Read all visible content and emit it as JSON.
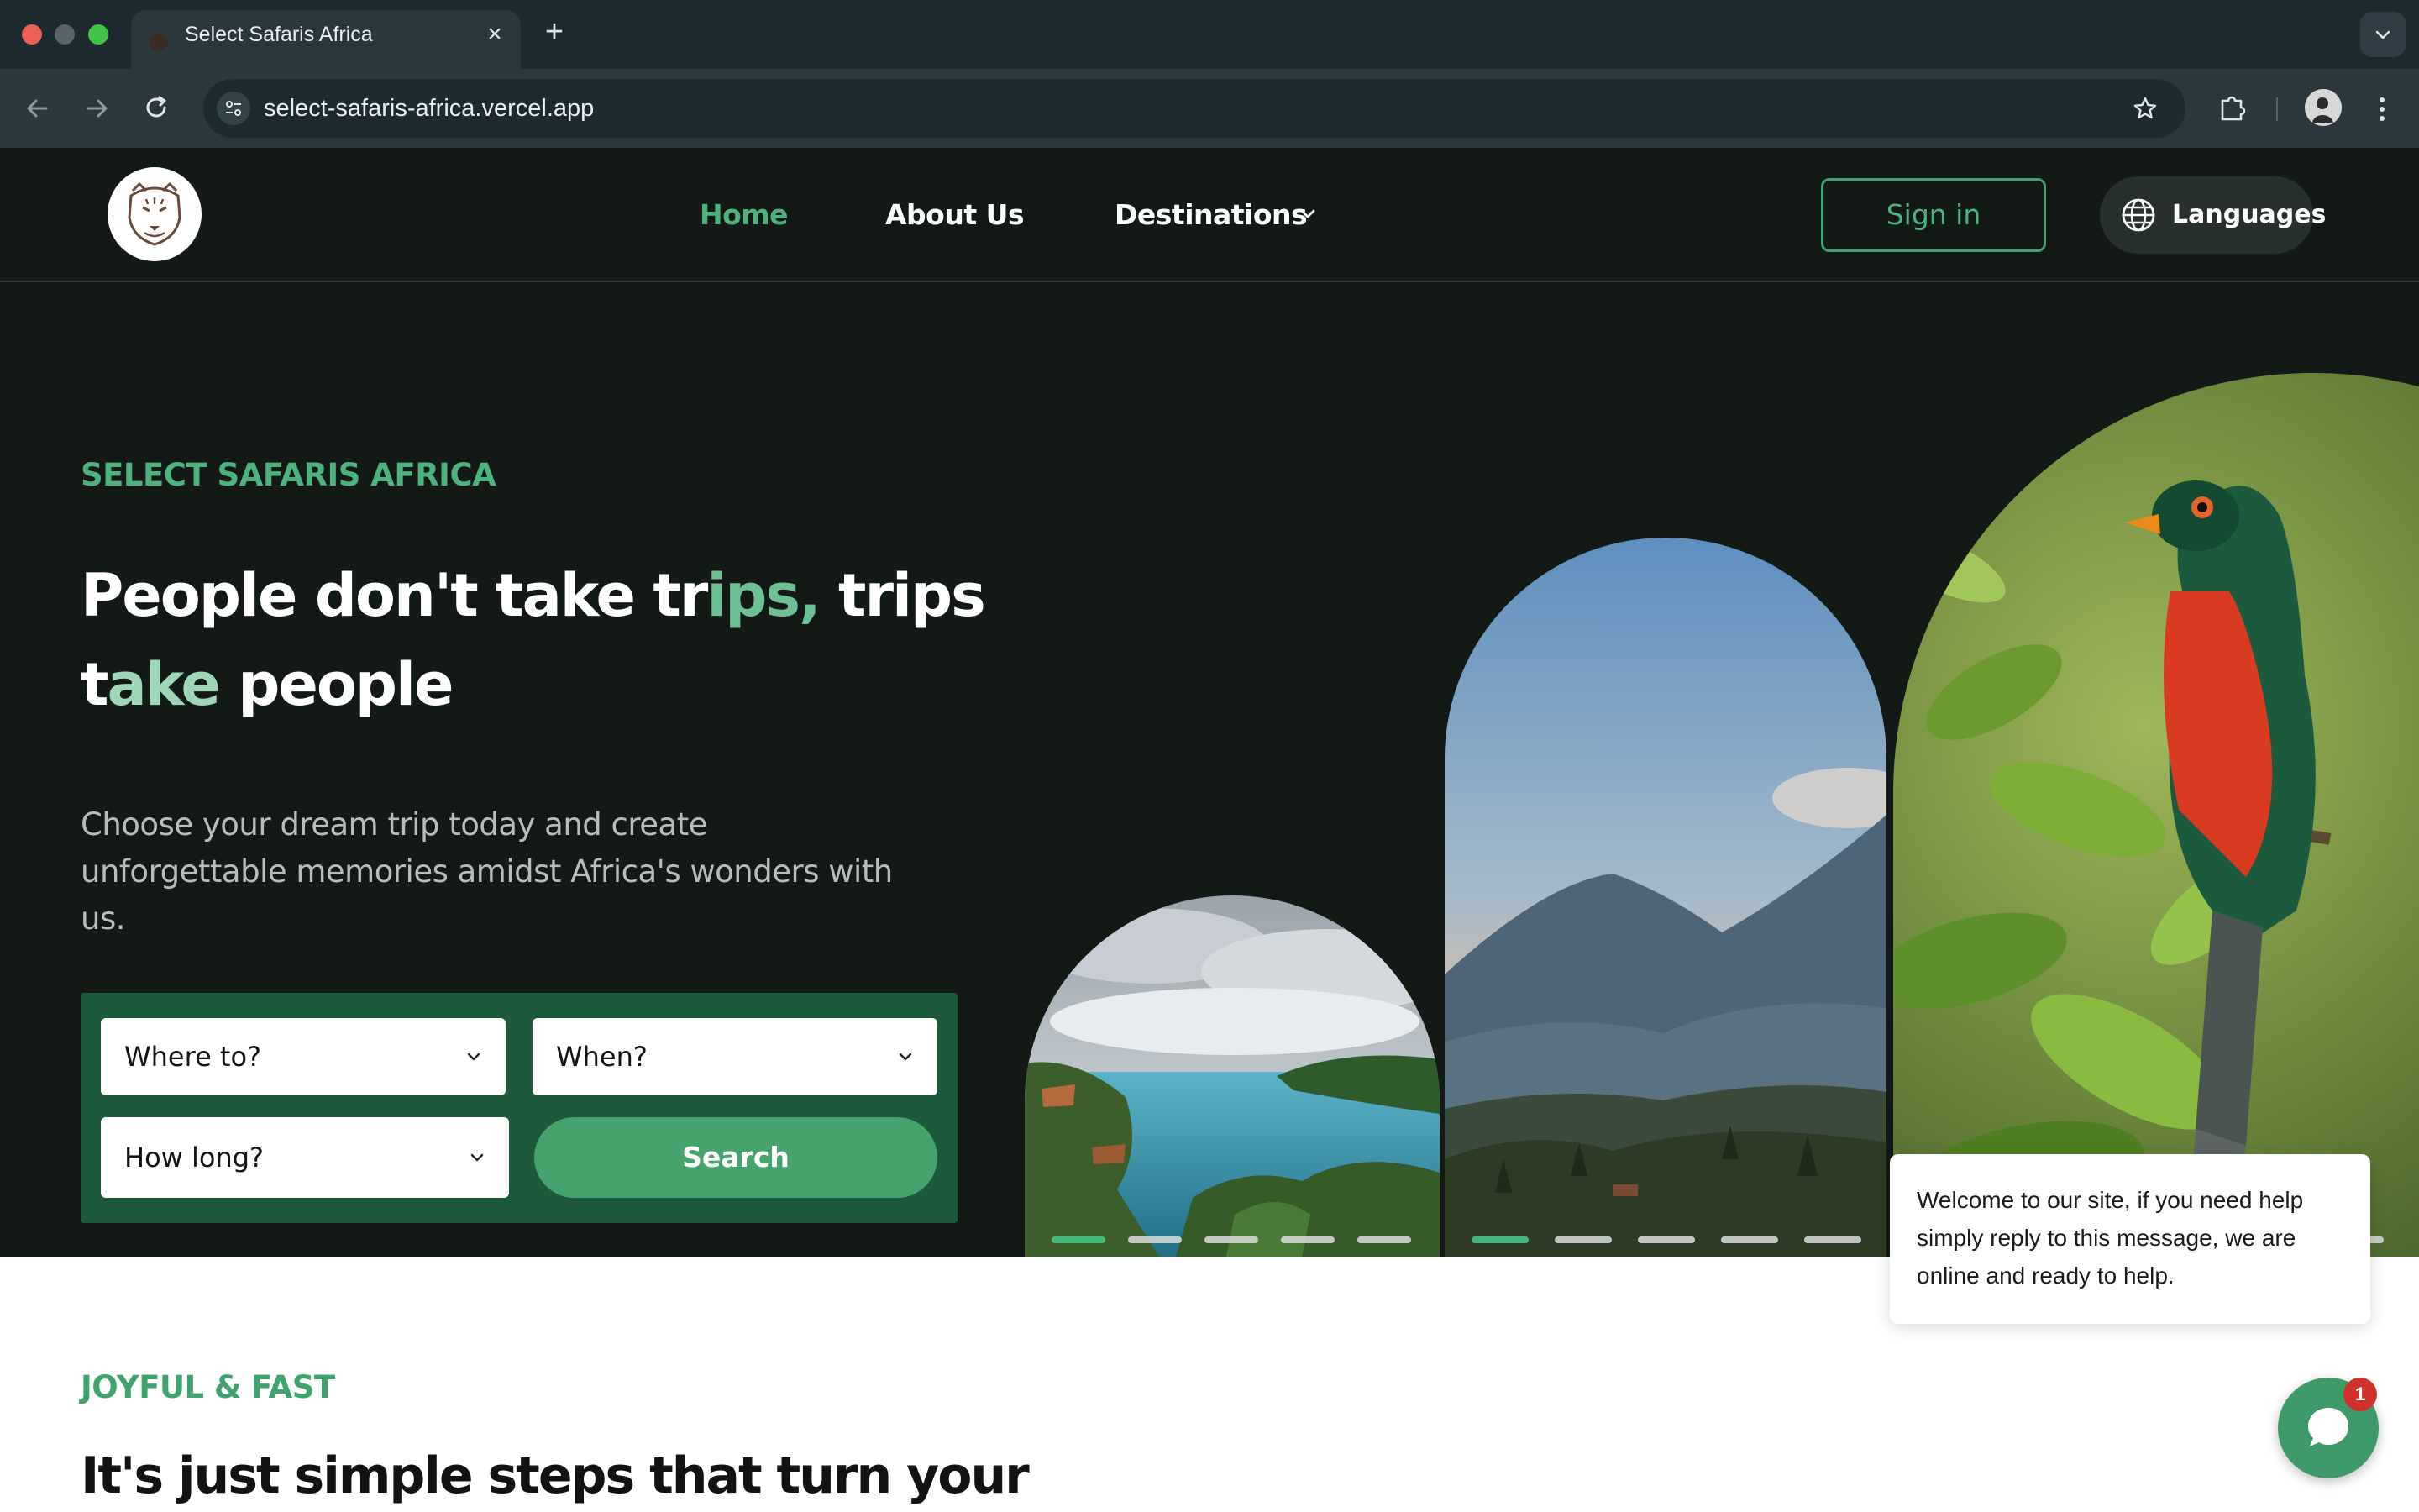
{
  "browser": {
    "tab_title": "Select Safaris Africa",
    "url": "select-safaris-africa.vercel.app",
    "icons": [
      "back-icon",
      "forward-icon",
      "reload-icon",
      "site-info-icon",
      "star-icon",
      "extensions-icon",
      "profile-avatar",
      "kebab-menu-icon",
      "tab-search-icon"
    ]
  },
  "header": {
    "nav": {
      "home": "Home",
      "about": "About Us",
      "destinations": "Destinations"
    },
    "signin_label": "Sign in",
    "languages_label": "Languages"
  },
  "hero": {
    "eyebrow": "SELECT SAFARIS AFRICA",
    "headline_part1": "People don't take tr",
    "headline_accent1": "ips,",
    "headline_part2": " trips t",
    "headline_accent2": "ake",
    "headline_part3": " people",
    "subtext": "Choose your dream trip today and create unforgettable memories amidst Africa's wonders with us.",
    "search": {
      "where": "Where to?",
      "when": "When?",
      "how_long": "How long?",
      "button": "Search"
    },
    "carousels": [
      {
        "slides": 5,
        "active": 0
      },
      {
        "slides": 5,
        "active": 0
      }
    ]
  },
  "section2": {
    "eyebrow": "JOYFUL & FAST",
    "headline": "It's just simple steps that turn your"
  },
  "chat": {
    "message": "Welcome to our site, if you need help simply reply to this message, we are online and ready to help.",
    "badge_count": "1"
  },
  "colors": {
    "brand_green": "#4eb27f",
    "dark_bg": "#131a16",
    "panel_green": "#1d5a3b",
    "button_green": "#46a36e"
  }
}
